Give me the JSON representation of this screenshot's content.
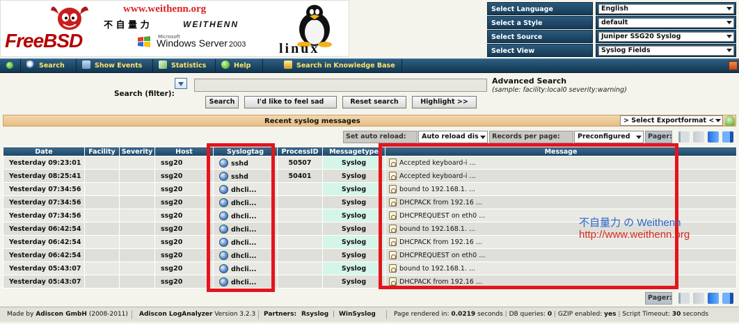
{
  "banner": {
    "url": "www.weithenn.org",
    "chinese": "不 自 量 力",
    "brand": "WEITHENN",
    "freebsd": "FreeBSD",
    "windows_small": "Microsoft",
    "windows": "Windows Server",
    "windows_year": "2003",
    "linux": "linux"
  },
  "settings": [
    {
      "label": "Select Language",
      "value": "English"
    },
    {
      "label": "Select a Style",
      "value": "default"
    },
    {
      "label": "Select Source",
      "value": "Juniper SSG20 Syslog"
    },
    {
      "label": "Select View",
      "value": "Syslog Fields"
    }
  ],
  "nav": [
    {
      "label": "Search",
      "icon": "magnifier-icon"
    },
    {
      "label": "Show Events",
      "icon": "house-icon"
    },
    {
      "label": "Statistics",
      "icon": "chart-icon"
    },
    {
      "label": "Help",
      "icon": "help-icon"
    },
    {
      "label": "Search in Knowledge Base",
      "icon": "book-icon"
    }
  ],
  "search": {
    "label": "Search (filter):",
    "value": "",
    "advanced_title": "Advanced Search",
    "advanced_sample": "(sample: facility:local0 severity:warning)",
    "buttons": [
      "Search",
      "I'd like to feel sad",
      "Reset search",
      "Highlight >>"
    ]
  },
  "section_title": "Recent syslog messages",
  "export_select": "> Select Exportformat <",
  "controls": {
    "auto_reload_label": "Set auto reload:",
    "auto_reload_value": "Auto reload dis",
    "records_label": "Records per page:",
    "records_value": "Preconfigured",
    "pager_label": "Pager:"
  },
  "table": {
    "columns": [
      "Date",
      "Facility",
      "Severity",
      "Host",
      "Syslogtag",
      "ProcessID",
      "Messagetype",
      "Message"
    ],
    "rows": [
      {
        "date": "Yesterday 09:23:01",
        "facility": "",
        "severity": "",
        "host": "ssg20",
        "tag": "sshd",
        "pid": "50507",
        "type": "Syslog",
        "message": "Accepted keyboard-i ..."
      },
      {
        "date": "Yesterday 08:25:41",
        "facility": "",
        "severity": "",
        "host": "ssg20",
        "tag": "sshd",
        "pid": "50401",
        "type": "Syslog",
        "message": "Accepted keyboard-i ..."
      },
      {
        "date": "Yesterday 07:34:56",
        "facility": "",
        "severity": "",
        "host": "ssg20",
        "tag": "dhcli...",
        "pid": "",
        "type": "Syslog",
        "message": "bound to 192.168.1. ..."
      },
      {
        "date": "Yesterday 07:34:56",
        "facility": "",
        "severity": "",
        "host": "ssg20",
        "tag": "dhcli...",
        "pid": "",
        "type": "Syslog",
        "message": "DHCPACK from 192.16 ..."
      },
      {
        "date": "Yesterday 07:34:56",
        "facility": "",
        "severity": "",
        "host": "ssg20",
        "tag": "dhcli...",
        "pid": "",
        "type": "Syslog",
        "message": "DHCPREQUEST on eth0 ..."
      },
      {
        "date": "Yesterday 06:42:54",
        "facility": "",
        "severity": "",
        "host": "ssg20",
        "tag": "dhcli...",
        "pid": "",
        "type": "Syslog",
        "message": "bound to 192.168.1. ..."
      },
      {
        "date": "Yesterday 06:42:54",
        "facility": "",
        "severity": "",
        "host": "ssg20",
        "tag": "dhcli...",
        "pid": "",
        "type": "Syslog",
        "message": "DHCPACK from 192.16 ..."
      },
      {
        "date": "Yesterday 06:42:54",
        "facility": "",
        "severity": "",
        "host": "ssg20",
        "tag": "dhcli...",
        "pid": "",
        "type": "Syslog",
        "message": "DHCPREQUEST on eth0 ..."
      },
      {
        "date": "Yesterday 05:43:07",
        "facility": "",
        "severity": "",
        "host": "ssg20",
        "tag": "dhcli...",
        "pid": "",
        "type": "Syslog",
        "message": "bound to 192.168.1. ..."
      },
      {
        "date": "Yesterday 05:43:07",
        "facility": "",
        "severity": "",
        "host": "ssg20",
        "tag": "dhcli...",
        "pid": "",
        "type": "Syslog",
        "message": "DHCPACK from 192.16 ..."
      }
    ]
  },
  "watermark": {
    "line1": "不自量力 の Weithenn",
    "line2": "http://www.weithenn.org"
  },
  "footer": {
    "made_by_prefix": "Made by",
    "made_by_company": "Adiscon GmbH",
    "made_by_years": "(2008-2011)",
    "product": "Adiscon LogAnalyzer",
    "version": "Version 3.2.3",
    "partners_label": "Partners:",
    "partner1": "Rsyslog",
    "partner2": "WinSyslog",
    "render_prefix": "Page rendered in:",
    "render_time": "0.0219",
    "render_suffix": "seconds",
    "db_prefix": "DB queries:",
    "db_value": "0",
    "gzip_prefix": "GZIP enabled:",
    "gzip_value": "yes",
    "timeout_prefix": "Script Timeout:",
    "timeout_value": "30",
    "timeout_suffix": "seconds"
  },
  "colors": {
    "nav_text": "#fce36a",
    "header_blue": "#1d4565",
    "highlight_red": "#e4141c",
    "watermark_blue": "#2a63c8",
    "watermark_red": "#d8261b"
  }
}
